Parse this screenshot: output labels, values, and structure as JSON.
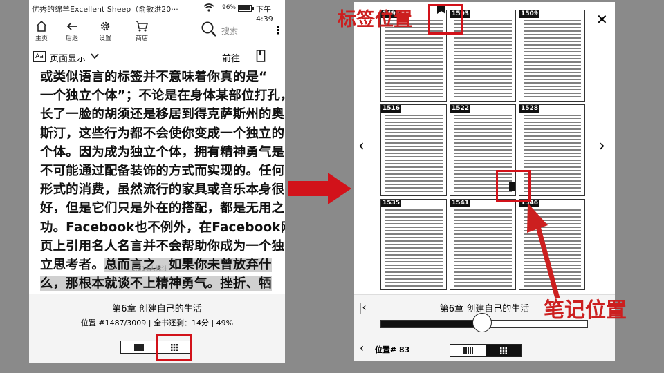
{
  "left": {
    "status": {
      "title": "优秀的绵羊Excellent Sheep（俞敏洪20···",
      "battery": "96%",
      "time": "下午4:39"
    },
    "toolbar": {
      "home": "主页",
      "back": "后退",
      "settings": "设置",
      "store": "商店",
      "search_placeholder": "搜索"
    },
    "pagebar": {
      "aa": "Aa",
      "page_display": "页面显示",
      "goto": "前往"
    },
    "reading_lines": [
      "或类似语言的标签并不意味着你真的是“",
      "一个独立个体”；不论是在身体某部位打孔，",
      "长了一脸的胡须还是移居到得克萨斯州的奥",
      "斯汀，这些行为都不会使你变成一个独立的",
      "个体。因为成为独立个体，拥有精神勇气是",
      "不可能通过配备装饰的方式而实现的。任何",
      "形式的消费，虽然流行的家具或音乐本身很",
      "好，但是它们只是外在的搭配，都是无用之",
      "功。Facebook也不例外，在Facebook网",
      "页上引用名人名言并不会帮助你成为一个独"
    ],
    "line11_plain": "立思考者。",
    "line11_hl": "总而言之，如果你未曾放弃什",
    "line12_hl": "么，那根本就谈不上精神勇气。挫折、牺",
    "note_hint": "1,214人标注",
    "chapter": "第6章 创建自己的生活",
    "progress": "位置 #1487/3009 | 全书还剩：14分 | 49%"
  },
  "right": {
    "thumb_numbers": [
      "1497",
      "1503",
      "1509",
      "1516",
      "1522",
      "1528",
      "1535",
      "1541",
      "1546"
    ],
    "chapter": "第6章 创建自己的生活",
    "slider_value": 0.49,
    "position": "位置# 83"
  },
  "annotations": {
    "bookmark_label": "标签位置",
    "note_label": "笔记位置"
  },
  "colors": {
    "annotation_red": "#d2121a",
    "highlight": "#d0d0d0"
  }
}
